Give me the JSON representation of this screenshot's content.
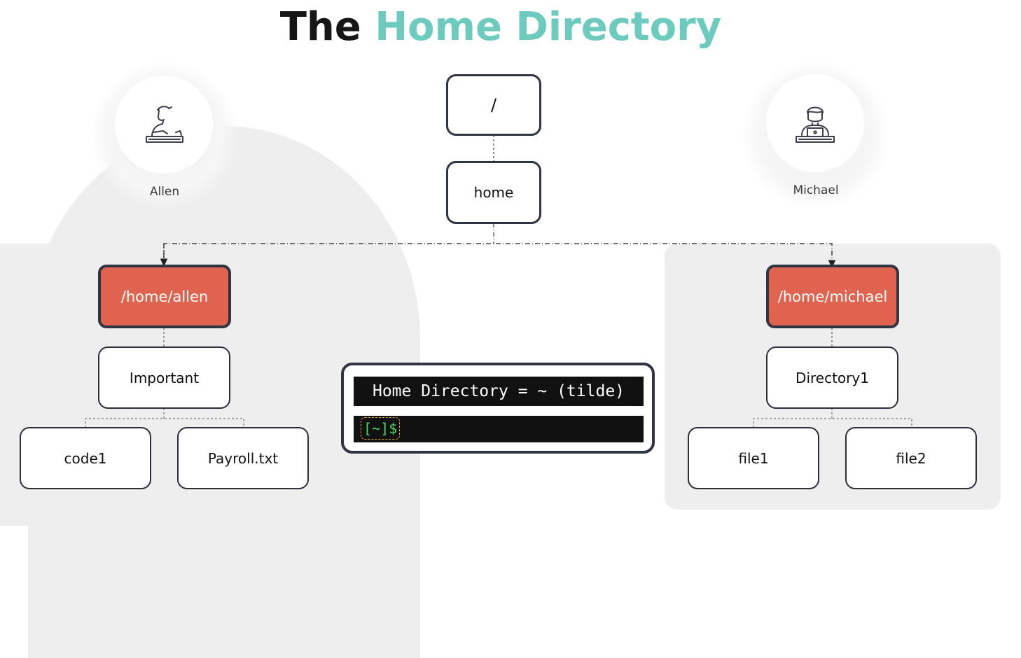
{
  "title": {
    "part1": "The",
    "part2": "Home Directory"
  },
  "users": {
    "left": {
      "name": "Allen",
      "icon": "user-sketch-icon"
    },
    "right": {
      "name": "Michael",
      "icon": "user-laptop-icon"
    }
  },
  "tree": {
    "root": "/",
    "home": "home",
    "allen_home": "/home/allen",
    "allen_child": "Important",
    "allen_leaf1": "code1",
    "allen_leaf2": "Payroll.txt",
    "michael_home": "/home/michael",
    "michael_child": "Directory1",
    "michael_leaf1": "file1",
    "michael_leaf2": "file2"
  },
  "terminal": {
    "heading": "Home Directory = ~ (tilde)",
    "prompt": "[~]$"
  },
  "colors": {
    "accent": "#6ccbbd",
    "home_node": "#e0634f",
    "prompt_green": "#4fd36b",
    "border": "#2f3542"
  }
}
